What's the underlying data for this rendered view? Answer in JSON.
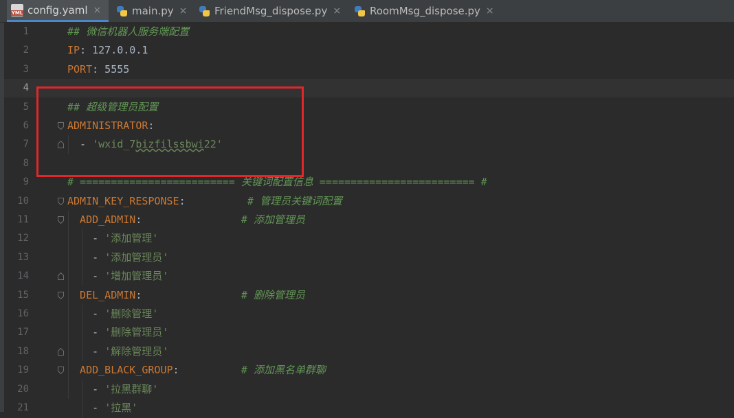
{
  "tabs": [
    {
      "label": "config.yaml",
      "icon": "yaml-file-icon",
      "active": true
    },
    {
      "label": "main.py",
      "icon": "python-file-icon",
      "active": false
    },
    {
      "label": "FriendMsg_dispose.py",
      "icon": "python-file-icon",
      "active": false
    },
    {
      "label": "RoomMsg_dispose.py",
      "icon": "python-file-icon",
      "active": false
    }
  ],
  "close_glyph": "×",
  "yaml_badge": "YML",
  "current_line": 4,
  "lines": [
    {
      "n": "1",
      "tokens": [
        {
          "t": "## 微信机器人服务端配置",
          "c": "com"
        }
      ]
    },
    {
      "n": "2",
      "tokens": [
        {
          "t": "IP",
          "c": "key"
        },
        {
          "t": ": 127.0.0.1",
          "c": "plain"
        }
      ]
    },
    {
      "n": "3",
      "tokens": [
        {
          "t": "PORT",
          "c": "key"
        },
        {
          "t": ": 5555",
          "c": "plain"
        }
      ]
    },
    {
      "n": "4",
      "tokens": []
    },
    {
      "n": "5",
      "tokens": [
        {
          "t": "## 超级管理员配置",
          "c": "com"
        }
      ]
    },
    {
      "n": "6",
      "tokens": [
        {
          "t": "ADMINISTRATOR",
          "c": "key"
        },
        {
          "t": ":",
          "c": "plain"
        }
      ]
    },
    {
      "n": "7",
      "tokens": [
        {
          "t": "  - ",
          "c": "plain"
        },
        {
          "t": "'wxid_7",
          "c": "str"
        },
        {
          "t": "bizfilssbwi",
          "c": "str wavy"
        },
        {
          "t": "22'",
          "c": "str"
        }
      ]
    },
    {
      "n": "8",
      "tokens": []
    },
    {
      "n": "9",
      "tokens": [
        {
          "t": "# ========================= 关键词配置信息 ========================= #",
          "c": "com"
        }
      ]
    },
    {
      "n": "10",
      "tokens": [
        {
          "t": "ADMIN_KEY_RESPONSE",
          "c": "key"
        },
        {
          "t": ":          ",
          "c": "plain"
        },
        {
          "t": "# 管理员关键词配置",
          "c": "com"
        }
      ]
    },
    {
      "n": "11",
      "tokens": [
        {
          "t": "  ADD_ADMIN",
          "c": "key"
        },
        {
          "t": ":                ",
          "c": "plain"
        },
        {
          "t": "# 添加管理员",
          "c": "com"
        }
      ]
    },
    {
      "n": "12",
      "tokens": [
        {
          "t": "    - ",
          "c": "plain"
        },
        {
          "t": "'添加管理'",
          "c": "str"
        }
      ]
    },
    {
      "n": "13",
      "tokens": [
        {
          "t": "    - ",
          "c": "plain"
        },
        {
          "t": "'添加管理员'",
          "c": "str"
        }
      ]
    },
    {
      "n": "14",
      "tokens": [
        {
          "t": "    - ",
          "c": "plain"
        },
        {
          "t": "'增加管理员'",
          "c": "str"
        }
      ]
    },
    {
      "n": "15",
      "tokens": [
        {
          "t": "  DEL_ADMIN",
          "c": "key"
        },
        {
          "t": ":                ",
          "c": "plain"
        },
        {
          "t": "# 删除管理员",
          "c": "com"
        }
      ]
    },
    {
      "n": "16",
      "tokens": [
        {
          "t": "    - ",
          "c": "plain"
        },
        {
          "t": "'删除管理'",
          "c": "str"
        }
      ]
    },
    {
      "n": "17",
      "tokens": [
        {
          "t": "    - ",
          "c": "plain"
        },
        {
          "t": "'删除管理员'",
          "c": "str"
        }
      ]
    },
    {
      "n": "18",
      "tokens": [
        {
          "t": "    - ",
          "c": "plain"
        },
        {
          "t": "'解除管理员'",
          "c": "str"
        }
      ]
    },
    {
      "n": "19",
      "tokens": [
        {
          "t": "  ADD_BLACK_GROUP",
          "c": "key"
        },
        {
          "t": ":          ",
          "c": "plain"
        },
        {
          "t": "# 添加黑名单群聊",
          "c": "com"
        }
      ]
    },
    {
      "n": "20",
      "tokens": [
        {
          "t": "    - ",
          "c": "plain"
        },
        {
          "t": "'拉黑群聊'",
          "c": "str"
        }
      ]
    },
    {
      "n": "21",
      "tokens": [
        {
          "t": "    - ",
          "c": "plain"
        },
        {
          "t": "'拉黑'",
          "c": "str"
        }
      ]
    }
  ],
  "colors": {
    "background": "#2b2b2b",
    "key": "#cc7832",
    "comment": "#629755",
    "string": "#6a8759",
    "highlight_box": "#e3262a"
  }
}
